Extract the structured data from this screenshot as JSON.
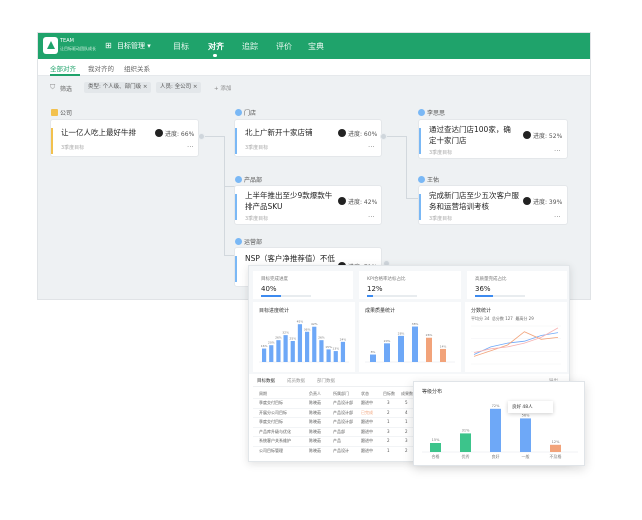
{
  "app": {
    "brand_line1": "TEAM",
    "brand_line2": "让目标驱动团队成长",
    "module": "目标管理 ▾",
    "nav": [
      "目标",
      "对齐",
      "追踪",
      "评价",
      "宝典"
    ],
    "active_nav": "对齐"
  },
  "tabs": [
    "全部对齐",
    "我对齐的",
    "组织关系"
  ],
  "filter": {
    "label": "筛选",
    "chips": [
      "类型: 个人级、部门级 ×",
      "人员: 全公司 ×"
    ],
    "add": "+ 添加"
  },
  "cards": {
    "company": {
      "header": "公司",
      "title": "让一亿人吃上最好牛排",
      "sub": "3季度目标",
      "progress": "进度: 66%",
      "more": "···"
    },
    "dept": {
      "header": "门店",
      "title": "北上广新开十家店铺",
      "sub": "3季度目标",
      "progress": "进度: 60%",
      "more": "···"
    },
    "product": {
      "header": "产品部",
      "title_1": "上半年推出至少9款爆款牛",
      "title_2": "排产品SKU",
      "sub": "3季度目标",
      "progress": "进度: 42%",
      "more": "···"
    },
    "ops": {
      "header": "运营部",
      "title": "NSP（客户净推荐值）不低",
      "progress": "进度: 71%"
    },
    "li": {
      "header": "李思思",
      "title_1": "通过查达门店100家，确",
      "title_2": "定十家门店",
      "sub": "3季度目标",
      "progress": "进度: 52%",
      "more": "···"
    },
    "wang": {
      "header": "王佑",
      "title_1": "完成新门店至少五次客户服",
      "title_2": "务和运营培训考核",
      "sub": "3季度目标",
      "progress": "进度: 39%",
      "more": "···"
    }
  },
  "dashboard": {
    "stats": [
      {
        "label": "目标完成进度",
        "value": "40%",
        "fill": 0.4
      },
      {
        "label": "KPI合格率达标占比",
        "value": "12%",
        "fill": 0.12
      },
      {
        "label": "高质量完成占比",
        "value": "36%",
        "fill": 0.36
      }
    ],
    "panel_titles": [
      "目标进度统计",
      "成果质量统计",
      "分数统计"
    ],
    "legend": [
      "平均分 34",
      "总分数 127",
      "最高分 29"
    ],
    "table_tabs": [
      "目标数据",
      "成员数据",
      "部门数据"
    ],
    "export": "导出",
    "table_headers": [
      "周期",
      "负责人",
      "所属部门",
      "状态",
      "目标数",
      "成果数"
    ],
    "table_rows": [
      [
        "季度交付目标",
        "陈晓茹",
        "产品设计部",
        "跟进中",
        "3",
        "5"
      ],
      [
        "开展分公司目标",
        "陈晓茹",
        "产品设计部",
        "已完成",
        "2",
        "4"
      ],
      [
        "季度交付目标",
        "陈晓茹",
        "产品设计部",
        "跟进中",
        "1",
        "1"
      ],
      [
        "产品库升级与优化",
        "陈晓茹",
        "产品部",
        "跟进中",
        "3",
        "2"
      ],
      [
        "系统客户关系维护",
        "陈晓茹",
        "产品",
        "跟进中",
        "2",
        "3"
      ],
      [
        "公司目标管理",
        "陈晓茹",
        "产品设计",
        "跟进中",
        "1",
        "2"
      ]
    ],
    "colors": {
      "blue": "#6ea8f7",
      "orange": "#f2a37a",
      "green": "#3cc48b",
      "brand": "#1fa36b"
    }
  },
  "chart_data": [
    {
      "type": "bar",
      "title": "目标进度统计",
      "categories": [
        "1",
        "2",
        "3",
        "4",
        "5",
        "6",
        "7",
        "8",
        "9",
        "10",
        "11",
        "12"
      ],
      "values": [
        16,
        20,
        26,
        32,
        25,
        45,
        36,
        42,
        26,
        15,
        13,
        24
      ],
      "ylim": [
        0,
        50
      ]
    },
    {
      "type": "bar",
      "title": "成果质量统计",
      "categories": [
        "A",
        "B",
        "C",
        "D",
        "E",
        "F"
      ],
      "values": [
        8,
        20,
        28,
        38,
        26,
        14
      ],
      "ylim": [
        0,
        45
      ]
    },
    {
      "type": "line",
      "title": "分数统计",
      "categories": [
        "1",
        "2",
        "3",
        "4",
        "5",
        "6"
      ],
      "series": [
        {
          "name": "平均分 34",
          "values": [
            10,
            18,
            22,
            24,
            30,
            33
          ]
        },
        {
          "name": "总分数 127",
          "values": [
            8,
            14,
            20,
            34,
            26,
            28
          ]
        },
        {
          "name": "最高分 29",
          "values": [
            12,
            16,
            18,
            22,
            28,
            38
          ]
        }
      ],
      "ylim": [
        0,
        40
      ]
    },
    {
      "type": "bar",
      "title": "等级分布",
      "categories": [
        "合格",
        "优秀",
        "良好",
        "一般",
        "不及格"
      ],
      "values": [
        15,
        31,
        72,
        56,
        12
      ],
      "data_labels": [
        "15%",
        "31%",
        "72%",
        "56%",
        "12%"
      ],
      "tooltip": "良好 48人",
      "ylim": [
        0,
        80
      ]
    }
  ]
}
